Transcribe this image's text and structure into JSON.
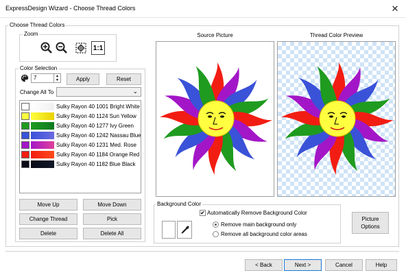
{
  "window": {
    "title": "ExpressDesign Wizard - Choose Thread Colors",
    "close_icon": "close-icon"
  },
  "main_group": {
    "label": "Choose Thread Colors"
  },
  "zoom": {
    "label": "Zoom",
    "buttons": [
      "zoom-in-icon",
      "zoom-out-icon",
      "zoom-fit-icon"
    ],
    "one_to_one": "1:1"
  },
  "color_selection": {
    "label": "Color Selection",
    "count_value": "7",
    "apply": "Apply",
    "reset": "Reset",
    "change_all_to": "Change All To",
    "change_all_value": ""
  },
  "threads": [
    {
      "label": "Sulky Rayon 40 1001 Bright White",
      "color": "#ffffff",
      "gradient": "#f0f0f0"
    },
    {
      "label": "Sulky Rayon 40 1124 Sun Yellow",
      "color": "#ffff40",
      "gradient": "#e8d000"
    },
    {
      "label": "Sulky Rayon 40 1277 Ivy Green",
      "color": "#1f9b1f",
      "gradient": "#0f7a20"
    },
    {
      "label": "Sulky Rayon 40 1242 Nassau Blue",
      "color": "#3a52d8",
      "gradient": "#6a6ae0"
    },
    {
      "label": "Sulky Rayon 40 1231 Med. Rose",
      "color": "#a316c7",
      "gradient": "#e0409a"
    },
    {
      "label": "Sulky Rayon 40 1184 Orange Red",
      "color": "#f21d12",
      "gradient": "#ff4a1a"
    },
    {
      "label": "Sulky Rayon 40 1182 Blue Black",
      "color": "#0a0a16",
      "gradient": "#101828"
    }
  ],
  "actions": {
    "move_up": "Move Up",
    "move_down": "Move Down",
    "change_thread": "Change Thread",
    "pick": "Pick",
    "delete": "Delete",
    "delete_all": "Delete All"
  },
  "source_picture": {
    "label": "Source Picture"
  },
  "preview": {
    "label": "Thread Color Preview"
  },
  "background": {
    "label": "Background Color",
    "auto_remove": "Automatically Remove Background Color",
    "auto_remove_checked": true,
    "remove_main": "Remove main background only",
    "remove_all": "Remove all background color areas",
    "selected": "remove_main"
  },
  "picture_options": {
    "line1": "Picture",
    "line2": "Options"
  },
  "footer": {
    "back": "< Back",
    "next": "Next >",
    "cancel": "Cancel",
    "help": "Help"
  }
}
